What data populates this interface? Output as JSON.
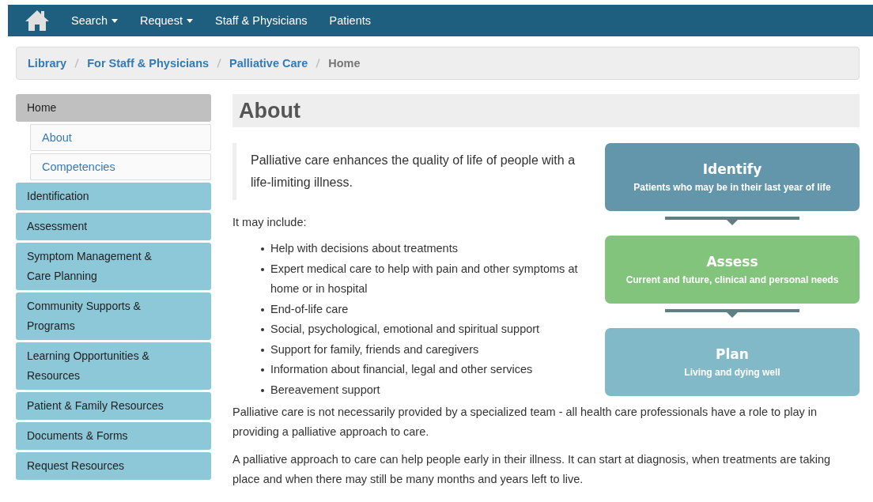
{
  "navbar": {
    "items": [
      {
        "label": "Search",
        "dropdown": true
      },
      {
        "label": "Request",
        "dropdown": true
      },
      {
        "label": "Staff & Physicians",
        "dropdown": false
      },
      {
        "label": "Patients",
        "dropdown": false
      }
    ]
  },
  "breadcrumb": [
    "Library",
    "For Staff & Physicians",
    "Palliative Care",
    "Home"
  ],
  "sidebar": {
    "items": [
      {
        "label": "Home",
        "selected": true,
        "children": [
          {
            "label": "About",
            "selected": false
          },
          {
            "label": "Competencies",
            "selected": false
          }
        ]
      },
      {
        "label": "Identification",
        "selected": false
      },
      {
        "label": "Assessment",
        "selected": false
      },
      {
        "label": "Symptom Management & Care Planning",
        "selected": false
      },
      {
        "label": "Community Supports & Programs",
        "selected": false
      },
      {
        "label": "Learning Opportunities & Resources",
        "selected": false
      },
      {
        "label": "Patient & Family Resources",
        "selected": false
      },
      {
        "label": "Documents & Forms",
        "selected": false
      },
      {
        "label": "Request Resources",
        "selected": false
      }
    ]
  },
  "main": {
    "title": "About",
    "quote": "Palliative care enhances the quality of life of people with a life-limiting illness.",
    "list_intro": "It may include:",
    "list": [
      "Help with decisions about treatments",
      "Expert medical care to help with pain and other symptoms at home or in hospital",
      "End-of-life care",
      "Social, psychological, emotional and spiritual support",
      "Support for family, friends and caregivers",
      "Information about financial, legal and other services",
      "Bereavement support"
    ],
    "diagram": [
      {
        "title": "Identify",
        "text": "Patients who may be in their last year of life",
        "color": "#6396ab"
      },
      {
        "title": "Assess",
        "text": "Current and future, clinical and personal needs",
        "color": "#82c47c"
      },
      {
        "title": "Plan",
        "text": "Living and dying well",
        "color": "#82b9c9"
      }
    ],
    "paragraphs": [
      "Palliative care is not necessarily provided by a specialized team - all health care professionals have a role to play in providing a palliative approach to care.",
      "A palliative approach to care can help people early in their illness. It can start at diagnosis, when treatments are taking place and when there may still be many months and years left to live."
    ]
  }
}
